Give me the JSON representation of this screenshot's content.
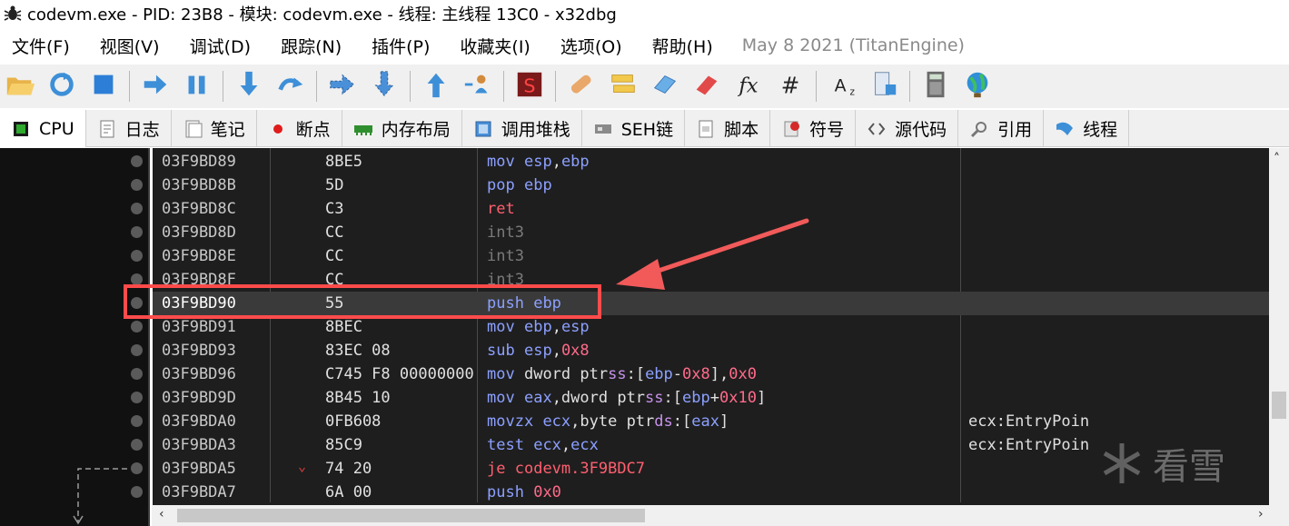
{
  "window": {
    "title": "codevm.exe - PID: 23B8 - 模块: codevm.exe - 线程: 主线程 13C0 - x32dbg"
  },
  "menu": {
    "items": [
      "文件(F)",
      "视图(V)",
      "调试(D)",
      "跟踪(N)",
      "插件(P)",
      "收藏夹(I)",
      "选项(O)",
      "帮助(H)"
    ],
    "version": "May 8 2021 (TitanEngine)"
  },
  "toolbar": {
    "buttons": [
      {
        "icon": "open-folder-icon",
        "group": 1
      },
      {
        "icon": "restart-icon",
        "group": 1
      },
      {
        "icon": "stop-icon",
        "group": 1
      },
      {
        "icon": "run-icon",
        "group": 2
      },
      {
        "icon": "pause-icon",
        "group": 2
      },
      {
        "icon": "step-into-icon",
        "group": 3
      },
      {
        "icon": "step-over-icon",
        "group": 3
      },
      {
        "icon": "trace-into-icon",
        "group": 4
      },
      {
        "icon": "trace-over-icon",
        "group": 4
      },
      {
        "icon": "execute-till-return-icon",
        "group": 5
      },
      {
        "icon": "run-to-user-code-icon",
        "group": 5
      },
      {
        "icon": "scylla-icon",
        "group": 6
      },
      {
        "icon": "patch-icon",
        "group": 7
      },
      {
        "icon": "comments-icon",
        "group": 7
      },
      {
        "icon": "labels-icon",
        "group": 7
      },
      {
        "icon": "bookmarks-icon",
        "group": 7
      },
      {
        "icon": "functions-icon",
        "group": 7
      },
      {
        "icon": "variables-icon",
        "group": 7
      },
      {
        "icon": "strings-icon",
        "group": 8
      },
      {
        "icon": "modules-icon",
        "group": 8
      },
      {
        "icon": "calculator-icon",
        "group": 9
      },
      {
        "icon": "globe-icon",
        "group": 9
      }
    ]
  },
  "tabs": [
    {
      "label": "CPU",
      "icon": "cpu-icon",
      "active": true
    },
    {
      "label": "日志",
      "icon": "log-icon",
      "active": false
    },
    {
      "label": "笔记",
      "icon": "notes-icon",
      "active": false
    },
    {
      "label": "断点",
      "icon": "breakpoint-icon",
      "active": false
    },
    {
      "label": "内存布局",
      "icon": "memory-map-icon",
      "active": false
    },
    {
      "label": "调用堆栈",
      "icon": "call-stack-icon",
      "active": false
    },
    {
      "label": "SEH链",
      "icon": "seh-icon",
      "active": false
    },
    {
      "label": "脚本",
      "icon": "script-icon",
      "active": false
    },
    {
      "label": "符号",
      "icon": "symbols-icon",
      "active": false
    },
    {
      "label": "源代码",
      "icon": "source-icon",
      "active": false
    },
    {
      "label": "引用",
      "icon": "references-icon",
      "active": false
    },
    {
      "label": "线程",
      "icon": "threads-icon",
      "active": false
    }
  ],
  "disassembly": [
    {
      "addr": "03F9BD89",
      "bytes": "8BE5",
      "mnemonic": "mov",
      "mclass": "normal",
      "ops": [
        [
          "esp",
          "reg"
        ],
        [
          ",",
          "txt"
        ],
        [
          "ebp",
          "reg"
        ]
      ],
      "comment": ""
    },
    {
      "addr": "03F9BD8B",
      "bytes": "5D",
      "mnemonic": "pop",
      "mclass": "normal",
      "ops": [
        [
          "ebp",
          "reg"
        ]
      ],
      "comment": ""
    },
    {
      "addr": "03F9BD8C",
      "bytes": "C3",
      "mnemonic": "ret",
      "mclass": "ret",
      "ops": [],
      "comment": ""
    },
    {
      "addr": "03F9BD8D",
      "bytes": "CC",
      "mnemonic": "int3",
      "mclass": "int3",
      "ops": [],
      "comment": ""
    },
    {
      "addr": "03F9BD8E",
      "bytes": "CC",
      "mnemonic": "int3",
      "mclass": "int3",
      "ops": [],
      "comment": ""
    },
    {
      "addr": "03F9BD8F",
      "bytes": "CC",
      "mnemonic": "int3",
      "mclass": "int3",
      "ops": [],
      "comment": ""
    },
    {
      "addr": "03F9BD90",
      "bytes": "55",
      "mnemonic": "push",
      "mclass": "normal",
      "ops": [
        [
          "ebp",
          "reg"
        ]
      ],
      "comment": "",
      "selected": true
    },
    {
      "addr": "03F9BD91",
      "bytes": "8BEC",
      "mnemonic": "mov",
      "mclass": "normal",
      "ops": [
        [
          "ebp",
          "reg"
        ],
        [
          ",",
          "txt"
        ],
        [
          "esp",
          "reg"
        ]
      ],
      "comment": ""
    },
    {
      "addr": "03F9BD93",
      "bytes": "83EC 08",
      "mnemonic": "sub",
      "mclass": "normal",
      "ops": [
        [
          "esp",
          "reg"
        ],
        [
          ",",
          "txt"
        ],
        [
          "0x8",
          "imm"
        ]
      ],
      "comment": ""
    },
    {
      "addr": "03F9BD96",
      "bytes": "C745 F8 00000000",
      "mnemonic": "mov",
      "mclass": "normal",
      "ops": [
        [
          "dword ptr",
          "txt"
        ],
        [
          "ss",
          "seg"
        ],
        [
          ":[",
          "txt"
        ],
        [
          "ebp",
          "reg"
        ],
        [
          "-",
          "txt"
        ],
        [
          "0x8",
          "imm"
        ],
        [
          "],",
          "txt"
        ],
        [
          "0x0",
          "imm"
        ]
      ],
      "comment": ""
    },
    {
      "addr": "03F9BD9D",
      "bytes": "8B45 10",
      "mnemonic": "mov",
      "mclass": "normal",
      "ops": [
        [
          "eax",
          "reg"
        ],
        [
          ",dword ptr",
          "txt"
        ],
        [
          "ss",
          "seg"
        ],
        [
          ":[",
          "txt"
        ],
        [
          "ebp",
          "reg"
        ],
        [
          "+",
          "txt"
        ],
        [
          "0x10",
          "imm"
        ],
        [
          "]",
          "txt"
        ]
      ],
      "comment": ""
    },
    {
      "addr": "03F9BDA0",
      "bytes": "0FB608",
      "mnemonic": "movzx",
      "mclass": "normal",
      "ops": [
        [
          "ecx",
          "reg"
        ],
        [
          ",byte ptr",
          "txt"
        ],
        [
          "ds",
          "seg"
        ],
        [
          ":[",
          "txt"
        ],
        [
          "eax",
          "reg"
        ],
        [
          "]",
          "txt"
        ]
      ],
      "comment": "ecx:EntryPoin"
    },
    {
      "addr": "03F9BDA3",
      "bytes": "85C9",
      "mnemonic": "test",
      "mclass": "normal",
      "ops": [
        [
          "ecx",
          "reg"
        ],
        [
          ",",
          "txt"
        ],
        [
          "ecx",
          "reg"
        ]
      ],
      "comment": "ecx:EntryPoin"
    },
    {
      "addr": "03F9BDA5",
      "bytes": "74 20",
      "mnemonic": "je",
      "mclass": "jmp",
      "ops": [
        [
          "codevm.3F9BDC7",
          "jmp"
        ]
      ],
      "comment": "",
      "arrow": "⌄"
    },
    {
      "addr": "03F9BDA7",
      "bytes": "6A 00",
      "mnemonic": "push",
      "mclass": "normal",
      "ops": [
        [
          "0x0",
          "imm"
        ]
      ],
      "comment": ""
    }
  ],
  "watermark": {
    "text": "看雪"
  },
  "colors": {
    "highlight": "#ff4b4b",
    "annotation_arrow": "#f25a5a"
  }
}
